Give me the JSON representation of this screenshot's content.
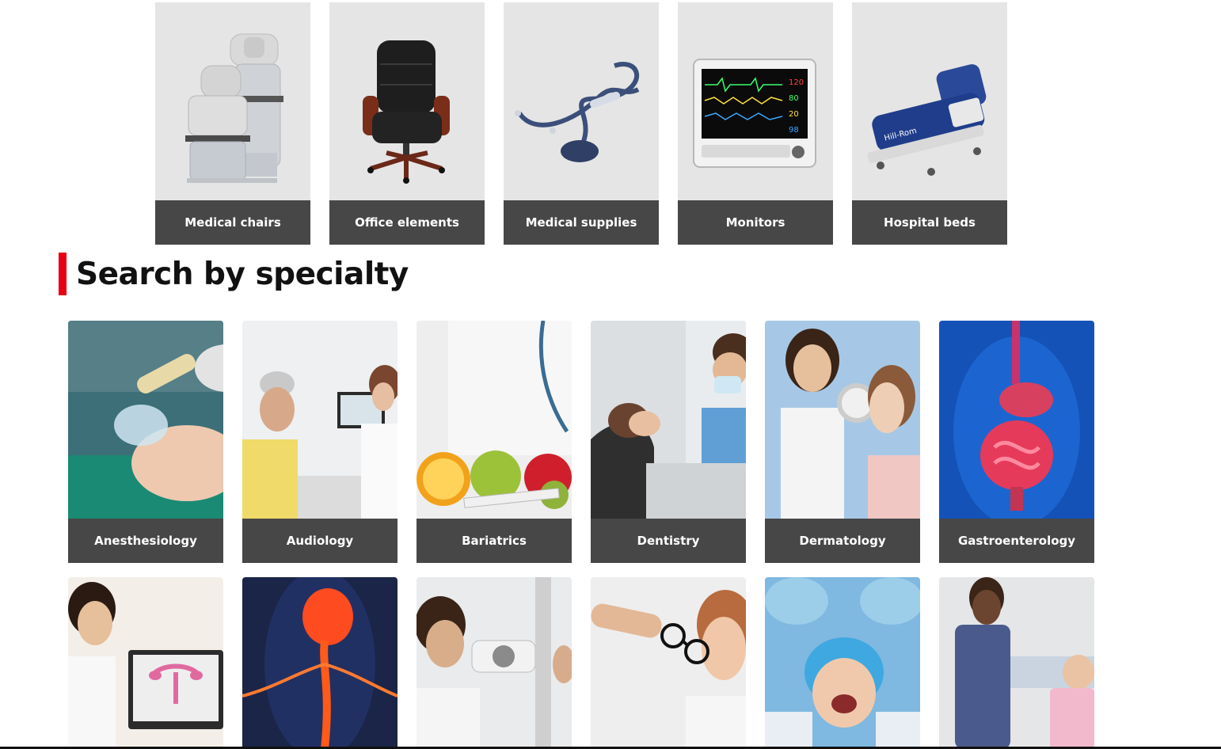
{
  "categories": [
    {
      "label": "Medical chairs",
      "icon": "medical-chair-icon"
    },
    {
      "label": "Office elements",
      "icon": "office-chair-icon"
    },
    {
      "label": "Medical supplies",
      "icon": "stethoscope-icon"
    },
    {
      "label": "Monitors",
      "icon": "patient-monitor-icon"
    },
    {
      "label": "Hospital beds",
      "icon": "hospital-bed-icon"
    }
  ],
  "section": {
    "title": "Search by specialty",
    "accent_color": "#e60012"
  },
  "specialties": [
    {
      "label": "Anesthesiology",
      "icon": "anesthesia-mask-photo"
    },
    {
      "label": "Audiology",
      "icon": "hearing-test-photo"
    },
    {
      "label": "Bariatrics",
      "icon": "fruit-measuring-tape-photo"
    },
    {
      "label": "Dentistry",
      "icon": "dentist-patient-photo"
    },
    {
      "label": "Dermatology",
      "icon": "skin-exam-photo"
    },
    {
      "label": "Gastroenterology",
      "icon": "digestive-system-photo"
    }
  ],
  "specialties_row2": [
    {
      "icon": "gynecology-photo"
    },
    {
      "icon": "neurology-photo"
    },
    {
      "icon": "ophthalmology-photo"
    },
    {
      "icon": "optometry-glasses-photo"
    },
    {
      "icon": "oral-surgery-photo"
    },
    {
      "icon": "physical-therapy-photo"
    }
  ],
  "colors": {
    "label_bg": "#474747",
    "card_bg": "#e5e5e5"
  }
}
